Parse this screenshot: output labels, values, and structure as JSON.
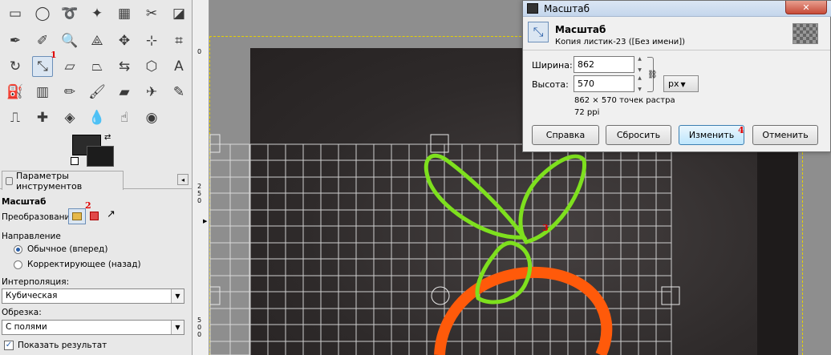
{
  "toolbox": {
    "tools": [
      {
        "name": "rect-select-icon",
        "glyph": "▭"
      },
      {
        "name": "ellipse-select-icon",
        "glyph": "◯"
      },
      {
        "name": "free-select-icon",
        "glyph": "➰"
      },
      {
        "name": "fuzzy-select-icon",
        "glyph": "✦"
      },
      {
        "name": "color-select-icon",
        "glyph": "▦"
      },
      {
        "name": "scissors-select-icon",
        "glyph": "✂"
      },
      {
        "name": "foreground-select-icon",
        "glyph": "◪"
      },
      {
        "name": "paths-icon",
        "glyph": "✒"
      },
      {
        "name": "color-picker-icon",
        "glyph": "✐"
      },
      {
        "name": "zoom-icon",
        "glyph": "🔍"
      },
      {
        "name": "measure-icon",
        "glyph": "⟁"
      },
      {
        "name": "move-icon",
        "glyph": "✥"
      },
      {
        "name": "align-icon",
        "glyph": "⊹"
      },
      {
        "name": "crop-icon",
        "glyph": "⌗"
      },
      {
        "name": "rotate-icon",
        "glyph": "↻"
      },
      {
        "name": "scale-icon",
        "glyph": "⤡"
      },
      {
        "name": "shear-icon",
        "glyph": "▱"
      },
      {
        "name": "perspective-icon",
        "glyph": "⏢"
      },
      {
        "name": "flip-icon",
        "glyph": "⇆"
      },
      {
        "name": "cage-icon",
        "glyph": "⬡"
      },
      {
        "name": "text-icon",
        "glyph": "A"
      },
      {
        "name": "bucket-fill-icon",
        "glyph": "⛽"
      },
      {
        "name": "blend-icon",
        "glyph": "▥"
      },
      {
        "name": "pencil-icon",
        "glyph": "✏"
      },
      {
        "name": "paintbrush-icon",
        "glyph": "🖌"
      },
      {
        "name": "eraser-icon",
        "glyph": "▰"
      },
      {
        "name": "airbrush-icon",
        "glyph": "✈"
      },
      {
        "name": "ink-icon",
        "glyph": "✎"
      },
      {
        "name": "clone-icon",
        "glyph": "⎍"
      },
      {
        "name": "heal-icon",
        "glyph": "✚"
      },
      {
        "name": "perspective-clone-icon",
        "glyph": "◈"
      },
      {
        "name": "blur-icon",
        "glyph": "💧"
      },
      {
        "name": "smudge-icon",
        "glyph": "☝"
      },
      {
        "name": "dodge-burn-icon",
        "glyph": "◉"
      }
    ],
    "markers": {
      "m1": "1",
      "m2": "2",
      "m3": "3",
      "m4": "4"
    },
    "tab_label": "Параметры инструментов",
    "options": {
      "title": "Масштаб",
      "transform_label": "Преобразование:",
      "direction_label": "Направление",
      "direction_normal": "Обычное (вперед)",
      "direction_corrective": "Корректирующее (назад)",
      "interpolation_label": "Интерполяция:",
      "interpolation_value": "Кубическая",
      "clipping_label": "Обрезка:",
      "clipping_value": "С полями",
      "show_result": "Показать результат"
    }
  },
  "ruler": {
    "marks_top": "0",
    "marks_mid": "250",
    "marks_bot": "500"
  },
  "dialog": {
    "window_title": "Масштаб",
    "close_glyph": "✕",
    "header_title": "Масштаб",
    "header_subtitle": "Копия листик-23 ([Без имени])",
    "width_label": "Ширина:",
    "width_value": "862",
    "height_label": "Высота:",
    "height_value": "570",
    "size_info": "862 × 570 точек растра",
    "resolution_info": "72 ppi",
    "unit": "px",
    "buttons": {
      "help": "Справка",
      "reset": "Сбросить",
      "scale": "Изменить",
      "cancel": "Отменить"
    }
  },
  "colors": {
    "leaf": "#7ee01e",
    "orange": "#ff5a0a",
    "grid": "#cfcfcf",
    "bg": "#2e2a2a"
  }
}
